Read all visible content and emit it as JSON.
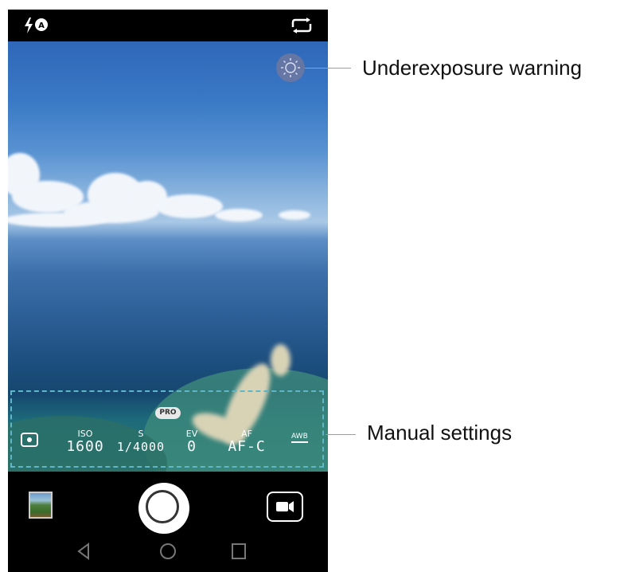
{
  "status_bar": {
    "flash_icon": "flash-auto-icon",
    "switch_camera_icon": "switch-camera-icon"
  },
  "manual_settings": {
    "pro_badge": "PRO",
    "metering_icon": "metering-icon",
    "items": [
      {
        "label": "ISO",
        "value": "1600"
      },
      {
        "label": "S",
        "value": "1/4000"
      },
      {
        "label": "EV",
        "value": "0"
      },
      {
        "label": "AF",
        "value": "AF-C"
      }
    ],
    "awb": "AWB"
  },
  "controls": {
    "gallery_icon": "gallery-thumbnail",
    "shutter_icon": "shutter-button",
    "video_icon": "video-camera-icon"
  },
  "nav": {
    "back_icon": "back-icon",
    "home_icon": "home-icon",
    "recents_icon": "recents-icon"
  },
  "annotations": {
    "underexposure": "Underexposure warning",
    "manual": "Manual settings"
  },
  "colors": {
    "callout": "#5fb6c6",
    "background": "#ffffff",
    "phone": "#000000"
  }
}
